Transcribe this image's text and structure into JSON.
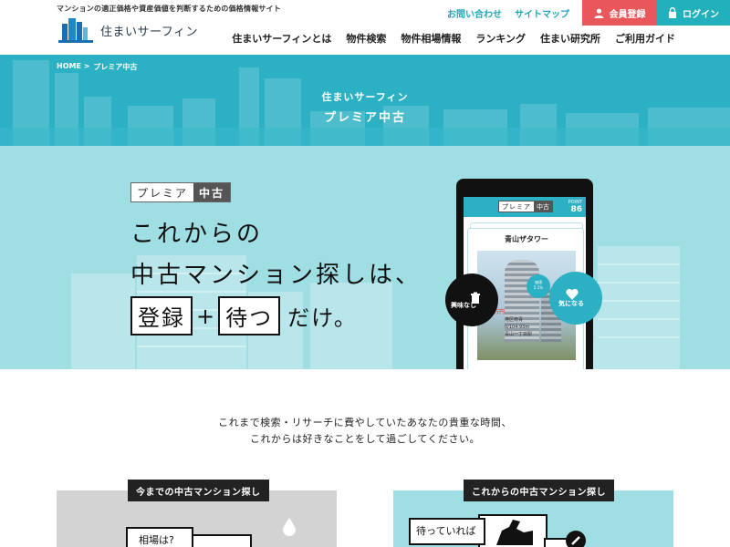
{
  "header": {
    "tagline": "マンションの適正価格や資産価値を判断するための価格情報サイト",
    "logo_text": "住まいサーフィン",
    "top_links": [
      "お問い合わせ",
      "サイトマップ"
    ],
    "register_label": "会員登録",
    "login_label": "ログイン",
    "nav": [
      "住まいサーフィンとは",
      "物件検索",
      "物件相場情報",
      "ランキング",
      "住まい研究所",
      "ご利用ガイド"
    ]
  },
  "breadcrumb": {
    "home": "HOME >",
    "current": "プレミア中古"
  },
  "band": {
    "title1": "住まいサーフィン",
    "title2": "プレミア中古"
  },
  "hero": {
    "logo_part1": "プレミア",
    "logo_part2": "中古",
    "line1": "これからの",
    "line2": "中古マンション探しは、",
    "box1": "登録",
    "plus": "+",
    "box2": "待つ",
    "tail": "だけ。"
  },
  "phone": {
    "logo_part1": "プレミア",
    "logo_part2": "中古",
    "point_label": "POINT",
    "point_value": "86",
    "property_name": "青山ザタワー",
    "price": "万円",
    "address_line1": "港区南青",
    "address_line2": "0/104.93m",
    "address_line3": "青山一丁目駅",
    "badge_line1": "価値",
    "badge_line2": "5.1%",
    "drop_label": "興味なし",
    "keep_label": "気になる"
  },
  "intro": {
    "line1": "これまで検索・リサーチに費やしていたあなたの貴重な時間、",
    "line2": "これからは好きなことをして過ごしてください。"
  },
  "comparison": {
    "left_label": "今までの中古マンション探し",
    "right_label": "これからの中古マンション探し",
    "left_bubble": "相場は?",
    "right_bubble": "待っていれば"
  },
  "colors": {
    "teal": "#2bb0c4",
    "light_teal": "#9fdee3",
    "red": "#e9575b"
  }
}
